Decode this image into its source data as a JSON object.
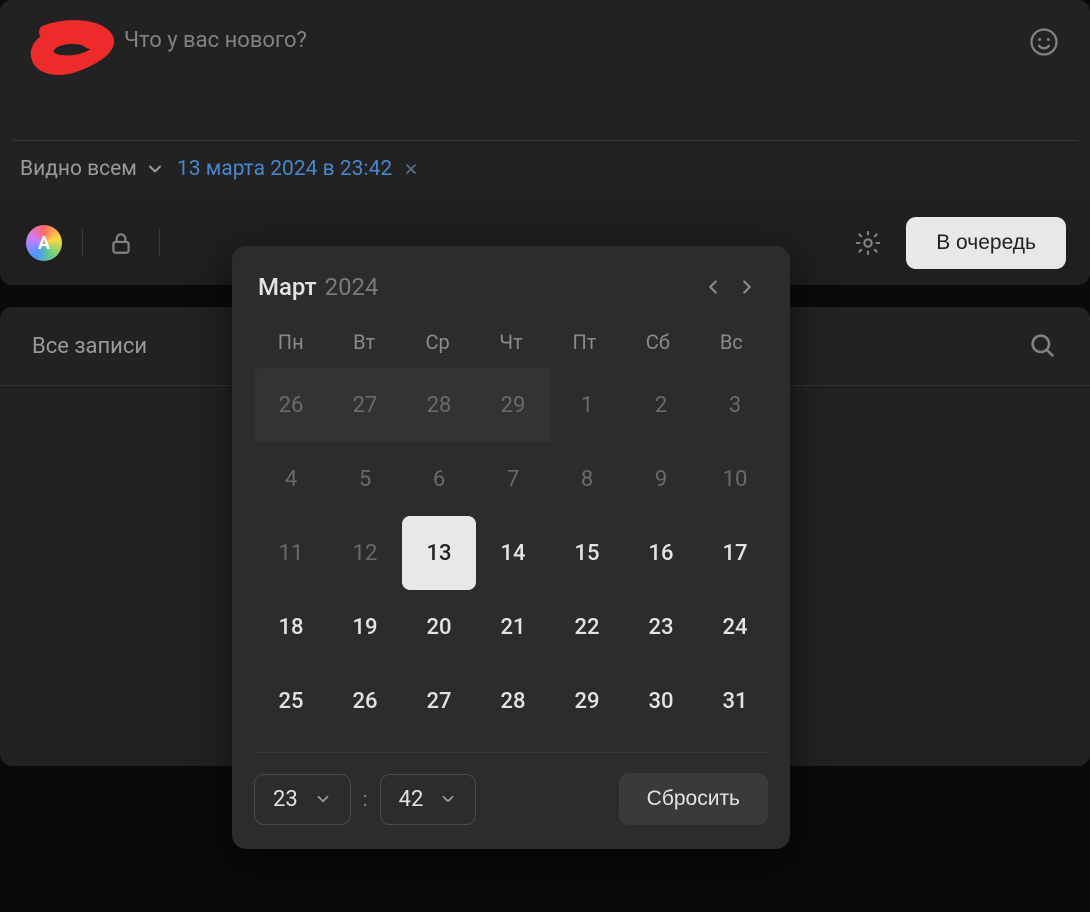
{
  "composer": {
    "placeholder": "Что у вас нового?",
    "visibility_label": "Видно всем",
    "scheduled_label": "13 марта 2024 в 23:42",
    "queue_button": "В очередь",
    "gradient_letter": "A"
  },
  "wall": {
    "tab_all": "Все записи"
  },
  "datepicker": {
    "month": "Март",
    "year": "2024",
    "dow": [
      "Пн",
      "Вт",
      "Ср",
      "Чт",
      "Пт",
      "Сб",
      "Вс"
    ],
    "cells": [
      {
        "d": "26",
        "prev": true
      },
      {
        "d": "27",
        "prev": true
      },
      {
        "d": "28",
        "prev": true
      },
      {
        "d": "29",
        "prev": true
      },
      {
        "d": "1",
        "dis": true
      },
      {
        "d": "2",
        "dis": true
      },
      {
        "d": "3",
        "dis": true
      },
      {
        "d": "4",
        "dis": true
      },
      {
        "d": "5",
        "dis": true
      },
      {
        "d": "6",
        "dis": true
      },
      {
        "d": "7",
        "dis": true
      },
      {
        "d": "8",
        "dis": true
      },
      {
        "d": "9",
        "dis": true
      },
      {
        "d": "10",
        "dis": true
      },
      {
        "d": "11",
        "dis": true
      },
      {
        "d": "12",
        "dis": true
      },
      {
        "d": "13",
        "sel": true
      },
      {
        "d": "14"
      },
      {
        "d": "15"
      },
      {
        "d": "16"
      },
      {
        "d": "17"
      },
      {
        "d": "18"
      },
      {
        "d": "19"
      },
      {
        "d": "20"
      },
      {
        "d": "21"
      },
      {
        "d": "22"
      },
      {
        "d": "23"
      },
      {
        "d": "24"
      },
      {
        "d": "25"
      },
      {
        "d": "26"
      },
      {
        "d": "27"
      },
      {
        "d": "28"
      },
      {
        "d": "29"
      },
      {
        "d": "30"
      },
      {
        "d": "31"
      }
    ],
    "hour": "23",
    "minute": "42",
    "reset": "Сбросить"
  }
}
